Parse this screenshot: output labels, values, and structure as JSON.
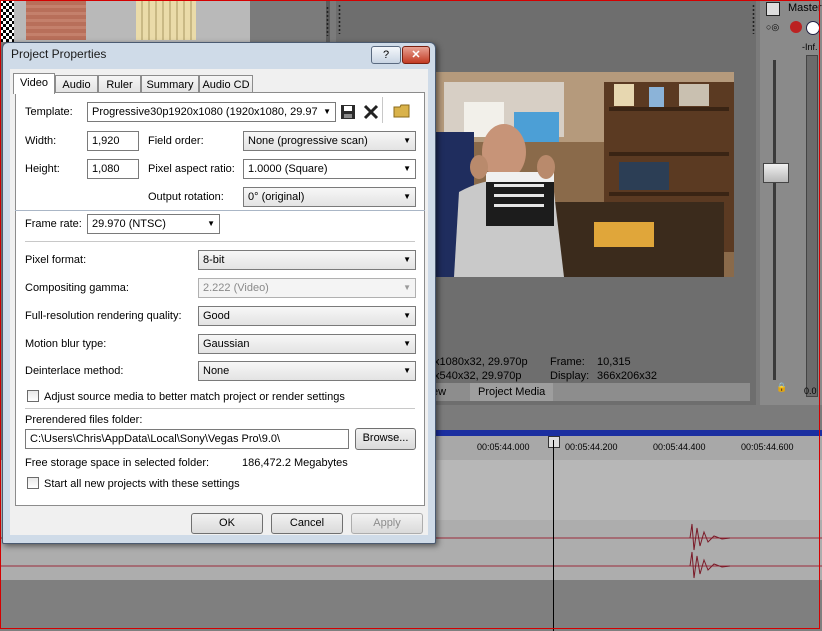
{
  "background_app": {
    "master_label": "Master",
    "master_level": "-Inf.",
    "master_bottom_value": "0.0",
    "preview_info": {
      "project_line": "x1080x32, 29.970p",
      "preview_line": "x540x32, 29.970p",
      "frame_label": "Frame:",
      "frame_value": "10,315",
      "display_label": "Display:",
      "display_value": "366x206x32"
    },
    "preview_tabs": {
      "partial_tab": "ew",
      "project_media": "Project Media"
    },
    "ruler_labels": [
      "00:05:44.000",
      "00:05:44.200",
      "00:05:44.400",
      "00:05:44.600"
    ]
  },
  "dialog": {
    "title": "Project Properties",
    "help_label": "?",
    "close_label": "✕",
    "tabs": [
      {
        "label": "Video",
        "active": true
      },
      {
        "label": "Audio",
        "active": false
      },
      {
        "label": "Ruler",
        "active": false
      },
      {
        "label": "Summary",
        "active": false
      },
      {
        "label": "Audio CD",
        "active": false
      }
    ],
    "video": {
      "template_label": "Template:",
      "template_value": "Progressive30p1920x1080 (1920x1080, 29.97",
      "width_label": "Width:",
      "width_value": "1,920",
      "height_label": "Height:",
      "height_value": "1,080",
      "field_order_label": "Field order:",
      "field_order_value": "None (progressive scan)",
      "pixel_aspect_label": "Pixel aspect ratio:",
      "pixel_aspect_value": "1.0000 (Square)",
      "output_rotation_label": "Output rotation:",
      "output_rotation_value": "0° (original)",
      "frame_rate_label": "Frame rate:",
      "frame_rate_value": "29.970 (NTSC)",
      "pixel_format_label": "Pixel format:",
      "pixel_format_value": "8-bit",
      "compositing_gamma_label": "Compositing gamma:",
      "compositing_gamma_value": "2.222 (Video)",
      "rendering_quality_label": "Full-resolution rendering quality:",
      "rendering_quality_value": "Good",
      "motion_blur_label": "Motion blur type:",
      "motion_blur_value": "Gaussian",
      "deinterlace_label": "Deinterlace method:",
      "deinterlace_value": "None",
      "adjust_source_label": "Adjust source media to better match project or render settings",
      "prerendered_label": "Prerendered files folder:",
      "prerendered_path": "C:\\Users\\Chris\\AppData\\Local\\Sony\\Vegas Pro\\9.0\\",
      "browse_label": "Browse...",
      "free_storage_label": "Free storage space in selected folder:",
      "free_storage_value": "186,472.2 Megabytes",
      "start_all_label": "Start all new projects with these settings"
    },
    "buttons": {
      "ok": "OK",
      "cancel": "Cancel",
      "apply": "Apply"
    }
  }
}
